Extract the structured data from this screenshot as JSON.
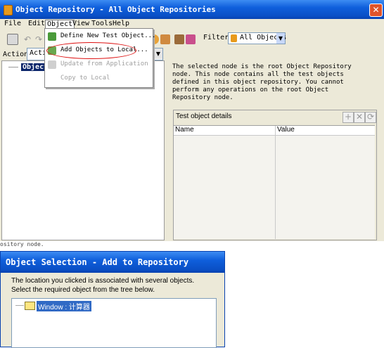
{
  "main_window": {
    "title": "Object Repository - All Object Repositories",
    "close_glyph": "✕",
    "menus": [
      "File",
      "Edit",
      "Object",
      "View",
      "Tools",
      "Help"
    ],
    "filter_label": "Filter:",
    "filter_value": "All Objects",
    "action_label": "Action:",
    "action_value": "Actio",
    "tree_root": "Object",
    "info_text": "The selected node is the root Object Repository node. This node contains all the test objects defined in this object repository. You cannot perform any operations on the root Object Repository node.",
    "details": {
      "title": "Test object details",
      "columns": [
        "Name",
        "Value"
      ],
      "buttons": [
        "+",
        "✕",
        "⟳"
      ]
    }
  },
  "object_menu": {
    "items": [
      {
        "label": "Define New Test Object...",
        "enabled": true,
        "icon": "define-object-icon"
      },
      {
        "label": "Add Objects to Local...",
        "enabled": true,
        "highlighted": true,
        "icon": "add-objects-icon"
      },
      {
        "label": "Update from Application",
        "enabled": false,
        "icon": "update-icon"
      },
      {
        "label": "Copy to Local",
        "enabled": false,
        "icon": "copy-icon"
      }
    ]
  },
  "gap_text": "ository node.",
  "dialog": {
    "title": "Object Selection - Add to Repository",
    "message_line1": "The location you clicked is associated with several objects.",
    "message_line2": "Select the required object from the tree below.",
    "tree_item": "Window : 计算器"
  },
  "colors": {
    "title_blue": "#0f5fdc",
    "selection_blue": "#316ac5",
    "highlight_red": "#d11111",
    "window_bg": "#ece9d8"
  }
}
